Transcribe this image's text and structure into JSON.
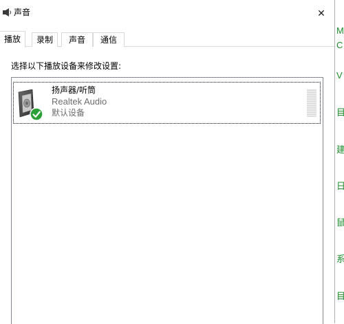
{
  "window": {
    "title": "声音",
    "close_glyph": "✕"
  },
  "tabs": [
    {
      "label": "播放",
      "active": true
    },
    {
      "label": "录制",
      "active": false
    },
    {
      "label": "声音",
      "active": false
    },
    {
      "label": "通信",
      "active": false
    }
  ],
  "playback": {
    "instruction": "选择以下播放设备来修改设置:",
    "devices": [
      {
        "name": "扬声器/听筒",
        "driver": "Realtek Audio",
        "status": "默认设备",
        "icon": "speaker-icon",
        "badge": "default-check-icon",
        "level": 0
      }
    ]
  },
  "background_window": {
    "chars": [
      "M",
      "C",
      "V",
      "目",
      "建",
      "日",
      "鼠",
      "系",
      "目"
    ]
  },
  "colors": {
    "check_green": "#2aa037",
    "background_text_green": "#1e8c2e",
    "meter_bar": "#dcdcdc"
  }
}
